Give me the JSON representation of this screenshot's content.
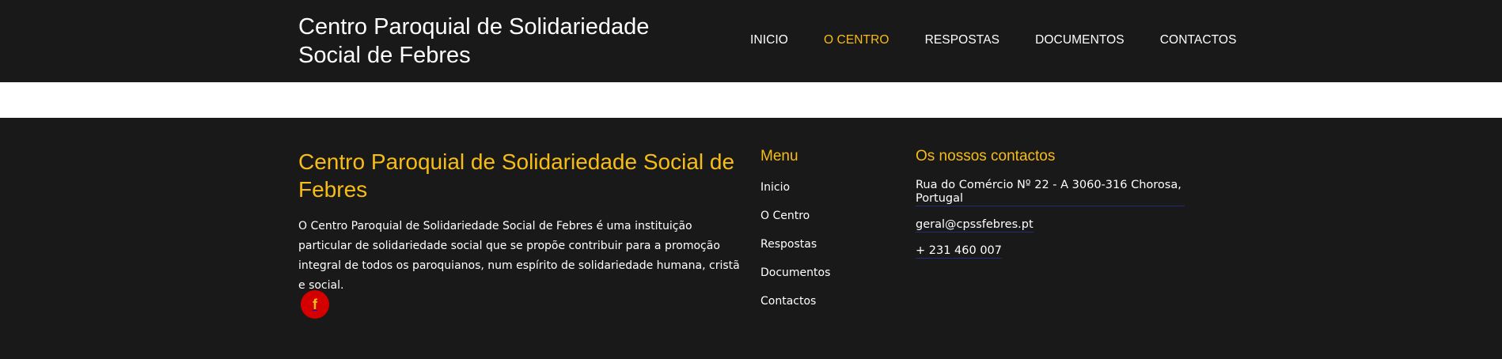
{
  "header": {
    "site_title": "Centro Paroquial de Solidariedade Social de Febres",
    "nav": [
      {
        "label": "INICIO",
        "active": false
      },
      {
        "label": "O CENTRO",
        "active": true
      },
      {
        "label": "RESPOSTAS",
        "active": false
      },
      {
        "label": "DOCUMENTOS",
        "active": false
      },
      {
        "label": "CONTACTOS",
        "active": false
      }
    ]
  },
  "footer": {
    "title": "Centro Paroquial de Solidariedade Social de Febres",
    "description": "O Centro Paroquial de Solidariedade Social de Febres é uma instituição particular de solidariedade social que se propõe contribuir para a promoção integral de todos os paroquianos, num espírito de solidariedade humana, cristã e social.",
    "social_icon": "facebook-icon",
    "menu": {
      "heading": "Menu",
      "items": [
        "Inicio",
        "O Centro",
        "Respostas",
        "Documentos",
        "Contactos"
      ]
    },
    "contacts": {
      "heading": "Os nossos contactos",
      "address": "Rua do Comércio Nº 22 - A 3060-316 Chorosa, Portugal",
      "email": "geral@cpssfebres.pt",
      "phone": "+ 231 460 007"
    }
  },
  "colors": {
    "background": "#191919",
    "accent": "#f7bd16",
    "facebook_bg": "#d40000"
  }
}
